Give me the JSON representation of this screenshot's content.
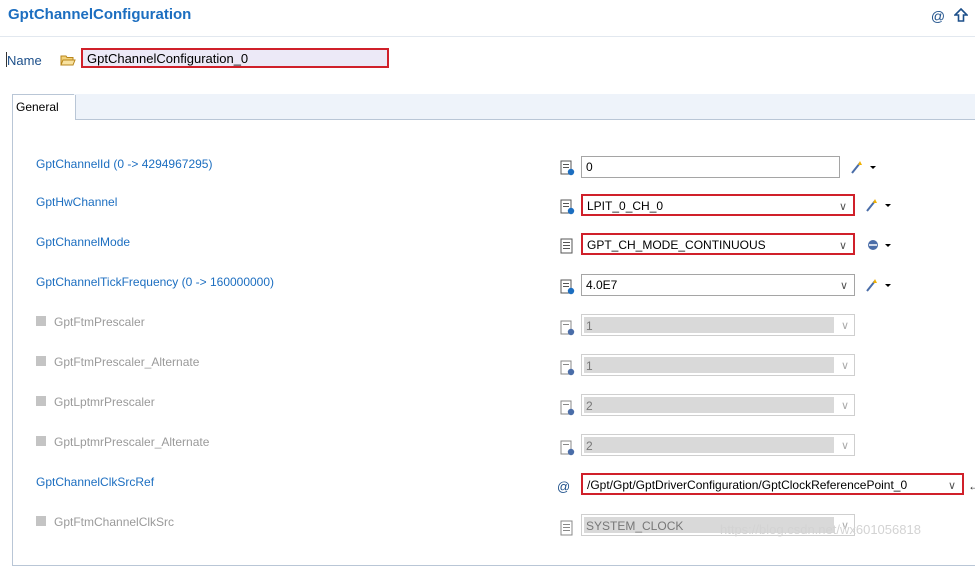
{
  "header": {
    "title": "GptChannelConfiguration",
    "at_icon": "at-icon",
    "up_icon": "arrow-up-icon"
  },
  "name_row": {
    "label": "Name",
    "value": "GptChannelConfiguration_0"
  },
  "tabs": [
    {
      "label": "General"
    }
  ],
  "fields": {
    "channel_id": {
      "label": "GptChannelId (0 -> 4294967295)",
      "value": "0"
    },
    "hw_channel": {
      "label": "GptHwChannel",
      "value": "LPIT_0_CH_0"
    },
    "channel_mode": {
      "label": "GptChannelMode",
      "value": "GPT_CH_MODE_CONTINUOUS"
    },
    "tick_frequency": {
      "label": "GptChannelTickFrequency (0 -> 160000000)",
      "value": "4.0E7"
    },
    "ftm_prescaler": {
      "label": "GptFtmPrescaler",
      "value": "1"
    },
    "ftm_prescaler_alt": {
      "label": "GptFtmPrescaler_Alternate",
      "value": "1"
    },
    "lptmr_prescaler": {
      "label": "GptLptmrPrescaler",
      "value": "2"
    },
    "lptmr_prescaler_alt": {
      "label": "GptLptmrPrescaler_Alternate",
      "value": "2"
    },
    "clk_src_ref": {
      "label": "GptChannelClkSrcRef",
      "value": "/Gpt/Gpt/GptDriverConfiguration/GptClockReferencePoint_0"
    },
    "ftm_clk_src": {
      "label": "GptFtmChannelClkSrc",
      "value": "SYSTEM_CLOCK"
    }
  },
  "watermark": "https://blog.csdn.net/wx601056818",
  "colors": {
    "accent": "#1c6ec0",
    "highlight_border": "#d0202a",
    "name_field_bg": "#ece9f7"
  }
}
